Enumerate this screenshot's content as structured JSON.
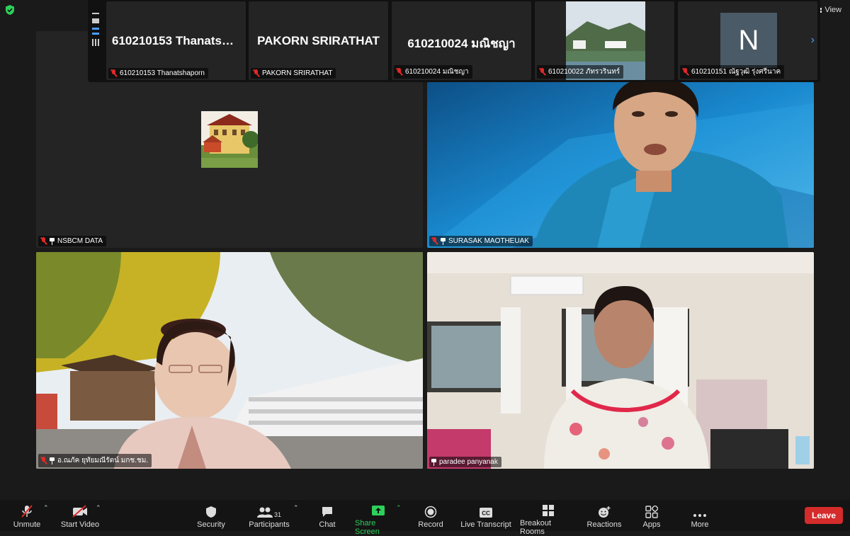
{
  "top": {
    "view_label": "View"
  },
  "filmstrip": {
    "tiles": [
      {
        "title": "610210153 Thanatsha...",
        "name": "610210153 Thanatshaporn"
      },
      {
        "title": "PAKORN SRIRATHAT",
        "name": "PAKORN SRIRATHAT"
      },
      {
        "title": "610210024 มณิชญา",
        "name": "610210024 มณิชญา"
      },
      {
        "title": "",
        "name": "610210022 ภัทรวรินทร์"
      },
      {
        "title": "N",
        "name": "610210151 ณัฐวุฒิ รุ่งศรีนาค"
      }
    ]
  },
  "grid": {
    "tiles": [
      {
        "name": "NSBCM DATA"
      },
      {
        "name": "SURASAK MAOTHEUAK"
      },
      {
        "name": "อ.ณภัค ยุทัยมณีรัตน์ มกช.ชม."
      },
      {
        "name": "paradee panyanak"
      }
    ]
  },
  "toolbar": {
    "unmute": "Unmute",
    "start_video": "Start Video",
    "security": "Security",
    "participants": "Participants",
    "participant_count": "31",
    "chat": "Chat",
    "share_screen": "Share Screen",
    "record": "Record",
    "live_transcript": "Live Transcript",
    "breakout_rooms": "Breakout Rooms",
    "reactions": "Reactions",
    "apps": "Apps",
    "more": "More",
    "leave": "Leave"
  },
  "colors": {
    "active_speaker": "#2dd05a",
    "leave": "#d42b2b",
    "muted": "#e02828"
  }
}
